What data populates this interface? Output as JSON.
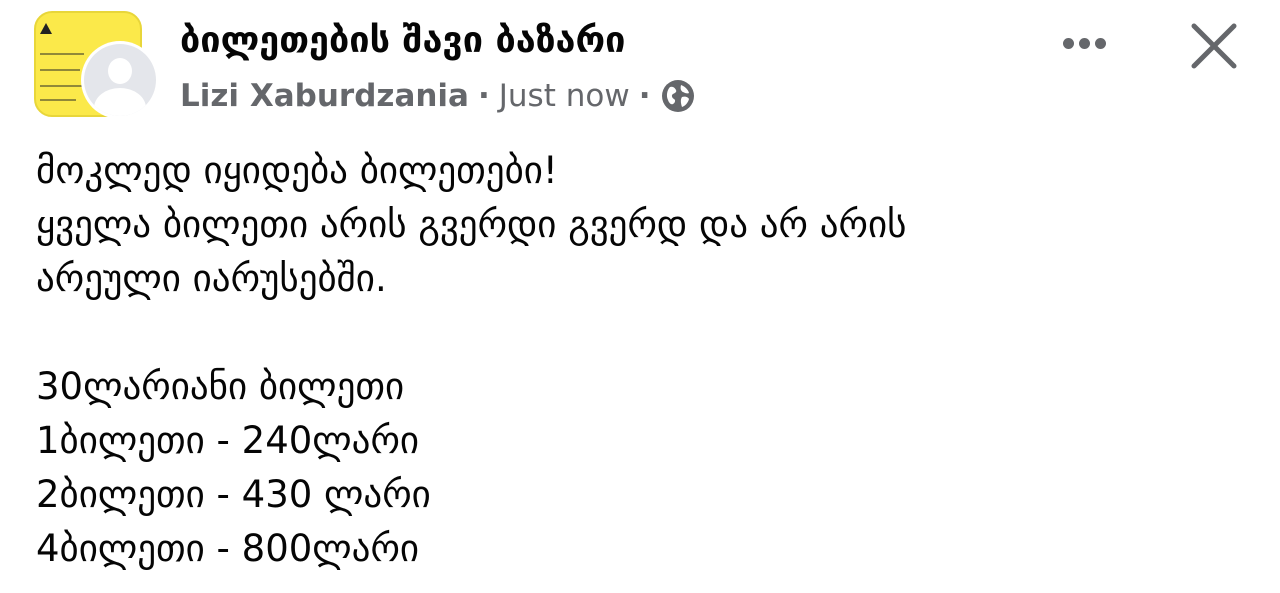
{
  "header": {
    "group_name": "ბილეთების შავი ბაზარი",
    "author": "Lizi Xaburdzania",
    "separator": "·",
    "timestamp": "Just now",
    "privacy_icon": "globe-icon",
    "more_icon": "more-horizontal-icon",
    "close_icon": "close-icon"
  },
  "post": {
    "lines": [
      "მოკლედ იყიდება ბილეთები!",
      "ყველა ბილეთი არის გვერდი გვერდ და არ არის",
      "არეული იარუსებში.",
      "",
      "30ლარიანი ბილეთი",
      "1ბილეთი - 240ლარი",
      "2ბილეთი - 430 ლარი",
      "4ბილეთი - 800ლარი"
    ]
  },
  "colors": {
    "group_avatar_bg": "#fbe94a",
    "text_primary": "#050505",
    "text_secondary": "#65676b"
  }
}
